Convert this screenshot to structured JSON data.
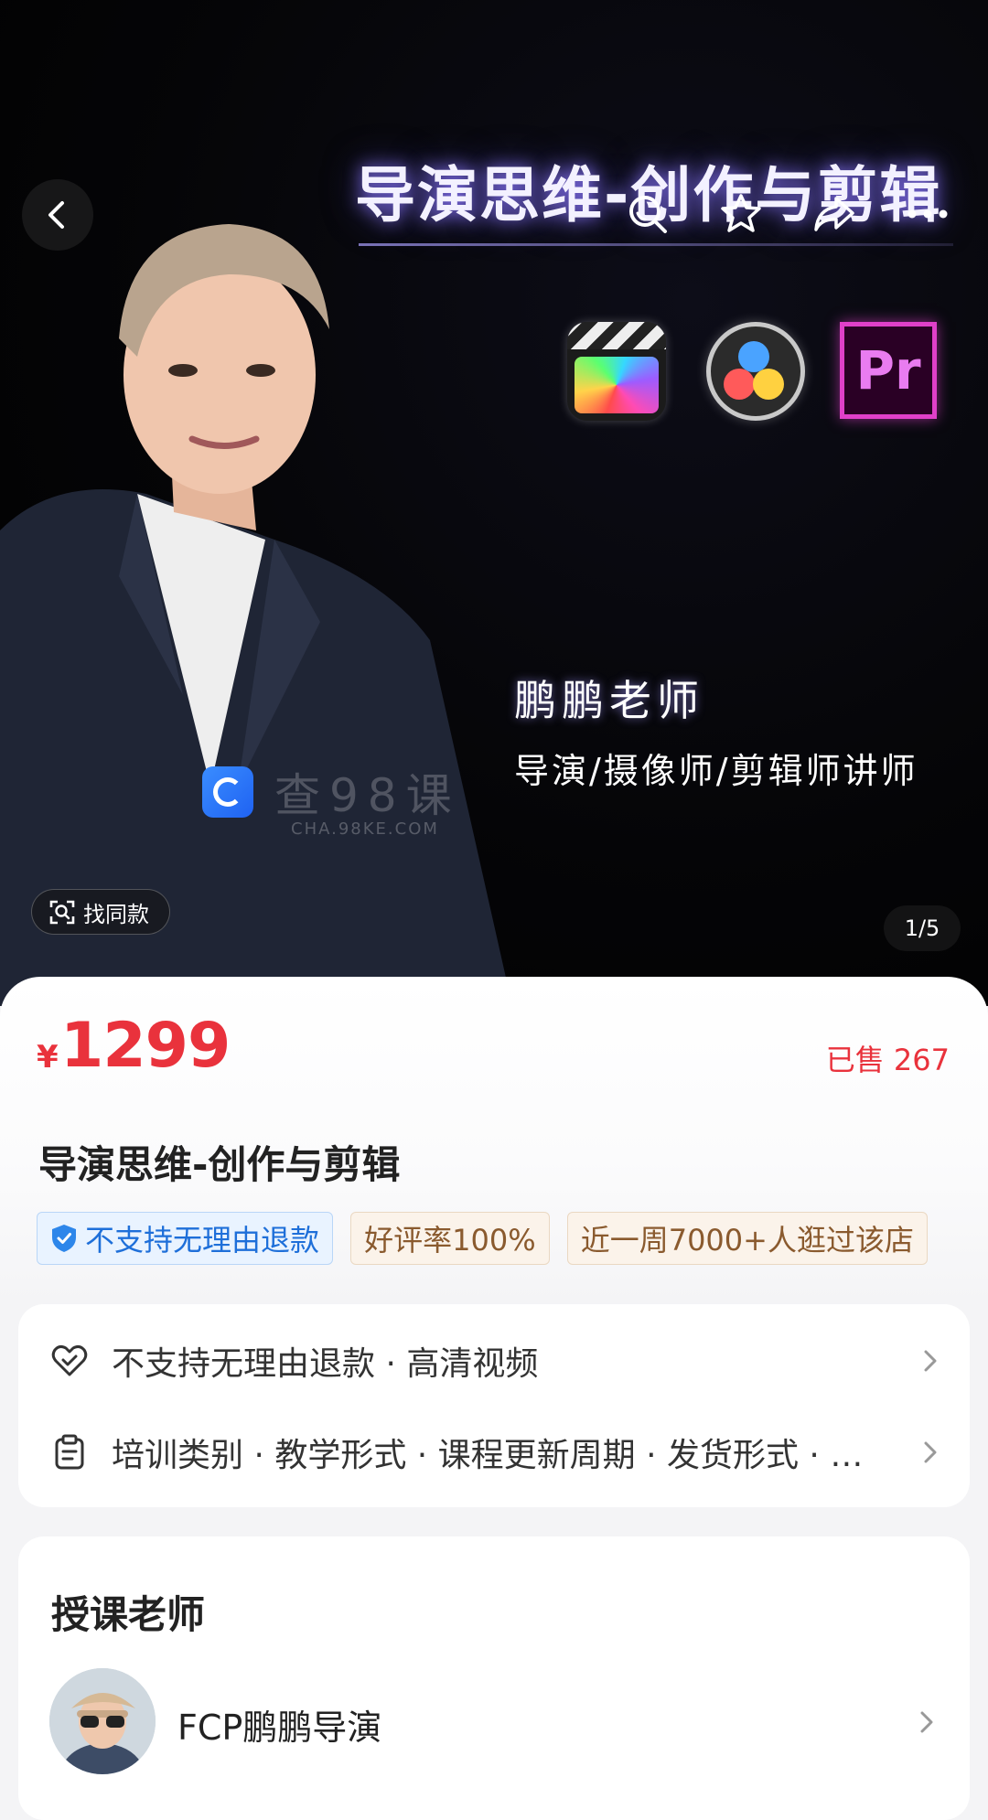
{
  "hero": {
    "title": "导演思维-创作与剪辑",
    "teacher_name": "鹏鹏老师",
    "teacher_role": "导演/摄像师/剪辑师讲师",
    "watermark_text": "查98课",
    "watermark_url": "CHA.98KE.COM",
    "find_same_label": "找同款",
    "pager": "1/5",
    "software_icons": [
      "final-cut-pro-icon",
      "davinci-resolve-icon",
      "premiere-pro-icon"
    ],
    "premiere_label": "Pr"
  },
  "nav": {
    "icons": [
      "back-icon",
      "search-icon",
      "star-icon",
      "share-icon",
      "more-icon"
    ]
  },
  "product": {
    "currency": "¥",
    "price": "1299",
    "sold": "已售 267",
    "title": "导演思维-创作与剪辑",
    "tags": [
      {
        "label": "不支持无理由退款",
        "style": "blue"
      },
      {
        "label": "好评率100%",
        "style": "tan"
      },
      {
        "label": "近一周7000+人逛过该店",
        "style": "tan"
      }
    ]
  },
  "info": {
    "service_row": "不支持无理由退款 · 高清视频",
    "params_row": "培训类别 · 教学形式 · 课程更新周期 · 发货形式 · …"
  },
  "teacher": {
    "heading": "授课老师",
    "name": "FCP鹏鹏导演"
  },
  "colors": {
    "price": "#e9323c",
    "tag_blue": "#1e6fd9",
    "tag_tan": "#8a5a2e"
  }
}
